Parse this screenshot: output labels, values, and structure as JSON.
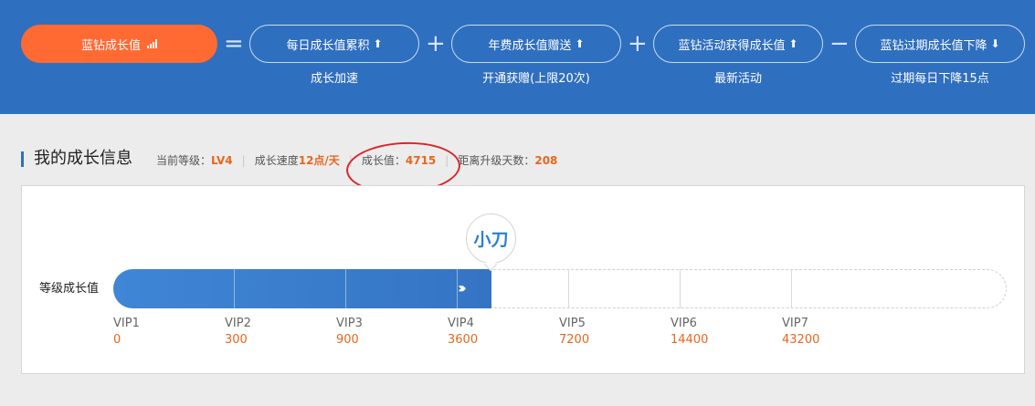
{
  "formula": {
    "main_label": "蓝钻成长值",
    "main_icon": "signal-bars-icon",
    "ops": [
      "=",
      "+",
      "+",
      "−"
    ],
    "terms": [
      {
        "label": "每日成长值累积",
        "arrow": "⬆",
        "sub": "成长加速"
      },
      {
        "label": "年费成长值赠送",
        "arrow": "⬆",
        "sub": "开通获赠(上限20次)"
      },
      {
        "label": "蓝钻活动获得成长值",
        "arrow": "⬆",
        "sub": "最新活动"
      },
      {
        "label": "蓝钻过期成长值下降",
        "arrow": "⬇",
        "sub": "过期每日下降15点"
      }
    ]
  },
  "section": {
    "title": "我的成长信息",
    "level_label": "当前等级：",
    "level_value": "LV4",
    "speed_label": "成长速度",
    "speed_value": "12点/天",
    "growth_label": "成长值：",
    "growth_value": "4715",
    "days_label": "距离升级天数：",
    "days_value": "208"
  },
  "progress": {
    "row_label": "等级成长值",
    "badge_text": "小刀",
    "current_growth": 4715,
    "chevrons": "›››",
    "levels": [
      {
        "name": "VIP1",
        "value": "0"
      },
      {
        "name": "VIP2",
        "value": "300"
      },
      {
        "name": "VIP3",
        "value": "900"
      },
      {
        "name": "VIP4",
        "value": "3600"
      },
      {
        "name": "VIP5",
        "value": "7200"
      },
      {
        "name": "VIP6",
        "value": "14400"
      },
      {
        "name": "VIP7",
        "value": "43200"
      }
    ]
  },
  "colors": {
    "header_blue": "#2f6fbf",
    "accent_orange": "#ff6a33",
    "value_orange": "#e8661c",
    "annotation_red": "#d8262b"
  }
}
